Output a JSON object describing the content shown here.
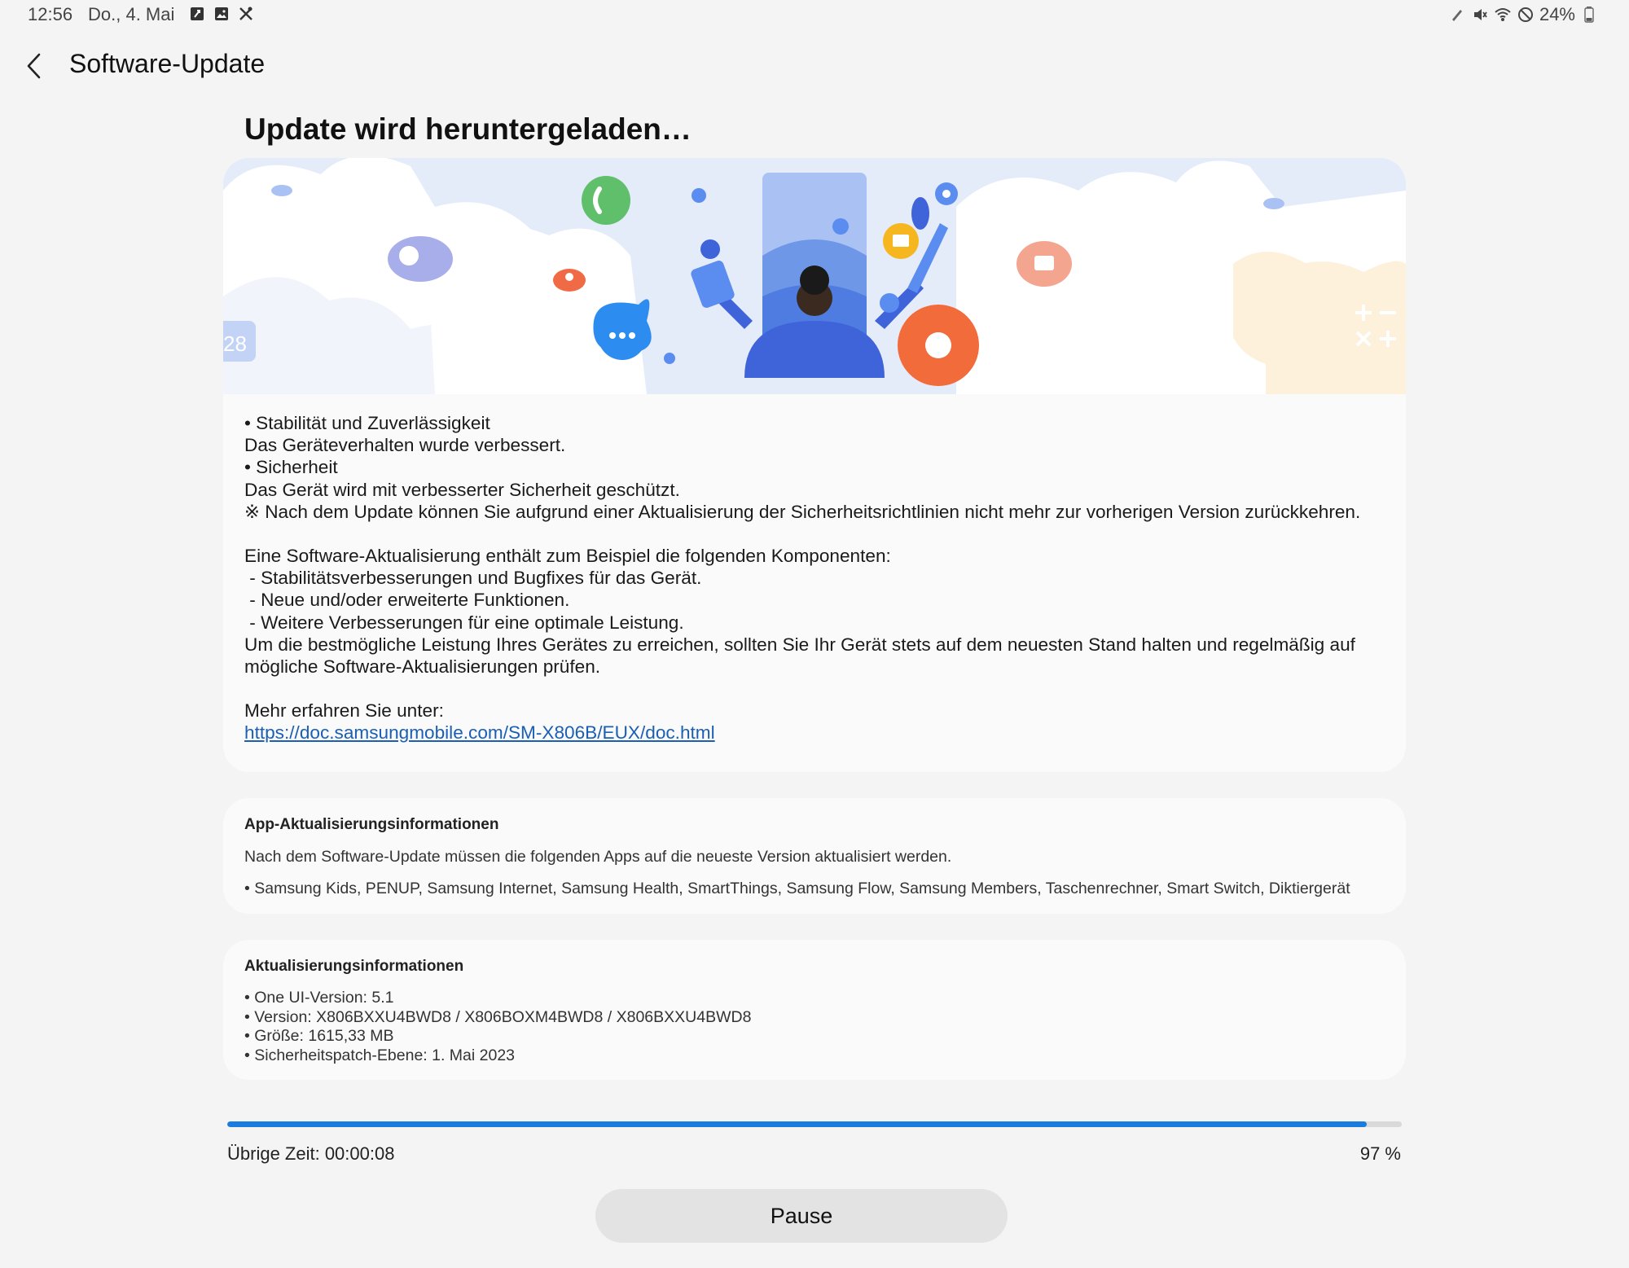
{
  "status_bar": {
    "time": "12:56",
    "date": "Do., 4. Mai",
    "left_icons": [
      "notification-app-icon",
      "image-icon",
      "tools-icon"
    ],
    "right_icons": [
      "pen-icon",
      "mute-icon",
      "wifi-icon",
      "do-not-disturb-icon",
      "battery-icon"
    ],
    "battery": "24%"
  },
  "header": {
    "title": "Software-Update",
    "back_icon": "chevron-left-icon"
  },
  "main": {
    "heading": "Update wird heruntergeladen…",
    "notes": [
      "• Stabilität und Zuverlässigkeit",
      "Das Geräteverhalten wurde verbessert.",
      "• Sicherheit",
      "Das Gerät wird mit verbesserter Sicherheit geschützt.",
      "※ Nach dem Update können Sie aufgrund einer Aktualisierung der Sicherheitsrichtlinien nicht mehr zur vorherigen Version zurückkehren.",
      "",
      "Eine Software-Aktualisierung enthält zum Beispiel die folgenden Komponenten:",
      " - Stabilitätsverbesserungen und Bugfixes für das Gerät.",
      " - Neue und/oder erweiterte Funktionen.",
      " - Weitere Verbesserungen für eine optimale Leistung.",
      "Um die bestmögliche Leistung Ihres Gerätes zu erreichen, sollten Sie Ihr Gerät stets auf dem neuesten Stand halten und regelmäßig auf",
      "mögliche Software-Aktualisierungen prüfen.",
      "",
      "Mehr erfahren Sie unter:"
    ],
    "link": "https://doc.samsungmobile.com/SM-X806B/EUX/doc.html",
    "hero_calendar_number": "28"
  },
  "app_info": {
    "title": "App-Aktualisierungsinformationen",
    "description": "Nach dem Software-Update müssen die folgenden Apps auf die neueste Version aktualisiert werden.",
    "apps": "• Samsung Kids, PENUP, Samsung Internet, Samsung Health, SmartThings, Samsung Flow, Samsung Members, Taschenrechner, Smart Switch, Diktiergerät"
  },
  "update_info": {
    "title": "Aktualisierungsinformationen",
    "lines": [
      "• One UI-Version: 5.1",
      "• Version: X806BXXU4BWD8 / X806BOXM4BWD8 / X806BXXU4BWD8",
      "• Größe: 1615,33 MB",
      "• Sicherheitspatch-Ebene: 1. Mai 2023"
    ]
  },
  "download": {
    "time_left": "Übrige Zeit: 00:00:08",
    "percent_label": "97 %",
    "progress": 0.97,
    "accent": "#1b7ce0"
  },
  "pause_button": {
    "label": "Pause"
  }
}
